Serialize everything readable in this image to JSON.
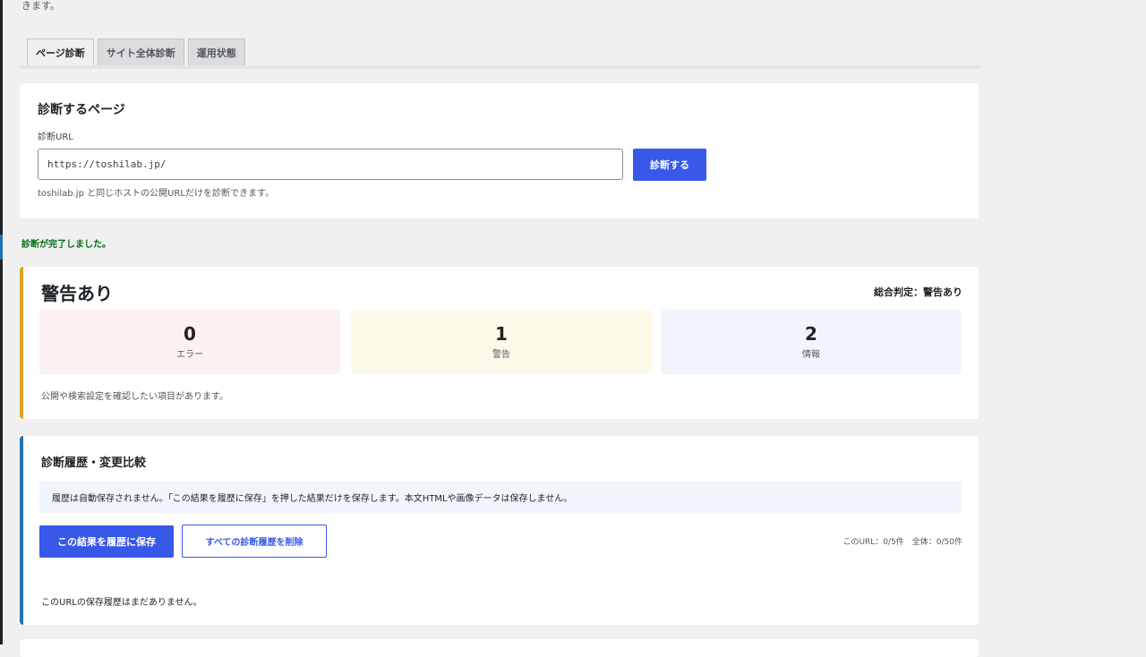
{
  "intro": {
    "text": "きます。"
  },
  "tabs": [
    {
      "label": "ページ診断",
      "active": true
    },
    {
      "label": "サイト全体診断",
      "active": false
    },
    {
      "label": "運用状態",
      "active": false
    }
  ],
  "url_section": {
    "title": "診断するページ",
    "label": "診断URL",
    "value": "https://toshilab.jp/",
    "button": "診断する",
    "help": "toshilab.jp と同じホストの公開URLだけを診断できます。"
  },
  "status": {
    "message": "診断が完了しました。"
  },
  "result": {
    "title": "警告あり",
    "overall": "総合判定：警告あり",
    "stats": [
      {
        "value": "0",
        "label": "エラー"
      },
      {
        "value": "1",
        "label": "警告"
      },
      {
        "value": "2",
        "label": "情報"
      }
    ],
    "note": "公開や検索設定を確認したい項目があります。"
  },
  "history": {
    "title": "診断履歴・変更比較",
    "notice": "履歴は自動保存されません。「この結果を履歴に保存」を押した結果だけを保存します。本文HTMLや画像データは保存しません。",
    "save_button": "この結果を履歴に保存",
    "delete_button": "すべての診断履歴を削除",
    "counts": "このURL：0/5件　全体：0/50件",
    "empty": "このURLの保存履歴はまだありません。"
  },
  "colors": {
    "primary": "#3858e9",
    "warning_border": "#dba617",
    "info_border": "#2271b1",
    "success_text": "#007017",
    "error_bg": "#fcf0f1",
    "warning_bg": "#fcf9e8",
    "info_bg": "#f0f6fc"
  }
}
